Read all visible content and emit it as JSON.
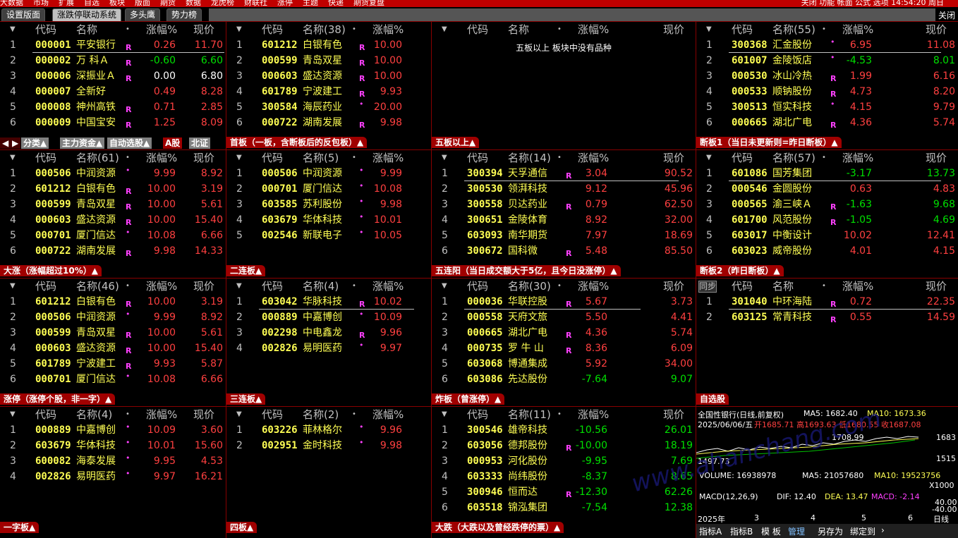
{
  "menubar": {
    "items": [
      "大数据",
      "市场",
      "扩展",
      "自选",
      "板块",
      "版面",
      "期货",
      "数据",
      "龙虎榜",
      "财联社",
      "涨停",
      "主题",
      "快递",
      "期货复盘"
    ],
    "right": "关闭 功能 帐面 公式 选项 14:54:20 周日"
  },
  "tabs": {
    "t1": "设置版面",
    "t2": "涨跌停联动系统",
    "t3": "多头鹰",
    "t4": "势力榜",
    "close": "关闭"
  },
  "colors": {
    "red": "#ff4040",
    "green": "#00e000",
    "code": "#ffff54",
    "grid": "#800000",
    "label": "#a00000"
  },
  "headers": {
    "code": "代码",
    "name": "名称",
    "pct": "涨幅%",
    "price": "现价",
    "sync": "同步"
  },
  "panels": [
    {
      "id": "p00",
      "title": "名称",
      "label": "",
      "rows": [
        [
          "1",
          "000001",
          "平安银行",
          "R",
          "0.26",
          "11.70",
          "r",
          "r"
        ],
        [
          "2",
          "000002",
          "万 科Ａ",
          "R",
          "-0.60",
          "6.60",
          "g",
          "g"
        ],
        [
          "3",
          "000006",
          "深振业Ａ",
          "R",
          "0.00",
          "6.80",
          "w",
          "w"
        ],
        [
          "4",
          "000007",
          "全新好",
          "",
          "0.49",
          "8.28",
          "r",
          "r"
        ],
        [
          "5",
          "000008",
          "神州高铁",
          "R",
          "0.71",
          "2.85",
          "r",
          "r"
        ],
        [
          "6",
          "000009",
          "中国宝安",
          "R",
          "1.25",
          "8.09",
          "r",
          "r"
        ]
      ]
    },
    {
      "id": "p01",
      "title": "名称(38)",
      "label": "首板（一板，含断板后的反包板）▲",
      "rows": [
        [
          "1",
          "601212",
          "白银有色",
          "R",
          "10.00",
          "",
          "r",
          "r"
        ],
        [
          "2",
          "000599",
          "青岛双星",
          "R",
          "10.00",
          "",
          "r",
          "r"
        ],
        [
          "3",
          "000603",
          "盛达资源",
          "R",
          "10.00",
          "",
          "r",
          "r"
        ],
        [
          "4",
          "601789",
          "宁波建工",
          "R",
          "9.93",
          "",
          "r",
          "r"
        ],
        [
          "5",
          "300584",
          "海辰药业",
          "•",
          "20.00",
          "",
          "r",
          "r"
        ],
        [
          "6",
          "000722",
          "湖南发展",
          "R",
          "9.98",
          "",
          "r",
          "r"
        ]
      ]
    },
    {
      "id": "p02",
      "title": "名称",
      "label": "五板以上▲",
      "empty": "五板以上 板块中没有品种",
      "rows": []
    },
    {
      "id": "p03",
      "title": "名称(55)",
      "label": "断板1（当日未更新则=昨日断板）▲",
      "rows": [
        [
          "1",
          "300368",
          "汇金股份",
          "•",
          "6.95",
          "11.08",
          "r",
          "r"
        ],
        [
          "2",
          "601007",
          "金陵饭店",
          "•",
          "-4.53",
          "8.01",
          "g",
          "g"
        ],
        [
          "3",
          "000530",
          "冰山冷热",
          "R",
          "1.99",
          "6.16",
          "r",
          "r"
        ],
        [
          "4",
          "000533",
          "顺钠股份",
          "R",
          "4.73",
          "8.20",
          "r",
          "r"
        ],
        [
          "5",
          "300513",
          "恒实科技",
          "•",
          "4.15",
          "9.79",
          "r",
          "r"
        ],
        [
          "6",
          "000665",
          "湖北广电",
          "R",
          "4.36",
          "5.74",
          "r",
          "r"
        ]
      ]
    },
    {
      "id": "p10",
      "title": "名称(61)",
      "label": "大涨（涨幅超过10%）▲",
      "rows": [
        [
          "1",
          "000506",
          "中润资源",
          "•",
          "9.99",
          "8.92",
          "r",
          "r"
        ],
        [
          "2",
          "601212",
          "白银有色",
          "R",
          "10.00",
          "3.19",
          "r",
          "r"
        ],
        [
          "3",
          "000599",
          "青岛双星",
          "R",
          "10.00",
          "5.61",
          "r",
          "r"
        ],
        [
          "4",
          "000603",
          "盛达资源",
          "R",
          "10.00",
          "15.40",
          "r",
          "r"
        ],
        [
          "5",
          "000701",
          "厦门信达",
          "•",
          "10.08",
          "6.66",
          "r",
          "r"
        ],
        [
          "6",
          "000722",
          "湖南发展",
          "R",
          "9.98",
          "14.33",
          "r",
          "r"
        ]
      ]
    },
    {
      "id": "p11",
      "title": "名称(5)",
      "label": "二连板▲",
      "rows": [
        [
          "1",
          "000506",
          "中润资源",
          "•",
          "9.99",
          "",
          "r",
          "r"
        ],
        [
          "2",
          "000701",
          "厦门信达",
          "•",
          "10.08",
          "",
          "r",
          "r"
        ],
        [
          "3",
          "603585",
          "苏利股份",
          "•",
          "9.98",
          "",
          "r",
          "r"
        ],
        [
          "4",
          "603679",
          "华体科技",
          "•",
          "10.01",
          "",
          "r",
          "r"
        ],
        [
          "5",
          "002546",
          "新联电子",
          "•",
          "10.05",
          "",
          "r",
          "r"
        ]
      ]
    },
    {
      "id": "p12",
      "title": "名称(14)",
      "label": "五连阳（当日成交额大于5亿，且今日没涨停）▲",
      "rows": [
        [
          "1",
          "300394",
          "天孚通信",
          "R",
          "3.04",
          "90.52",
          "r",
          "r"
        ],
        [
          "2",
          "300530",
          "领湃科技",
          "",
          "9.12",
          "45.96",
          "r",
          "r"
        ],
        [
          "3",
          "300558",
          "贝达药业",
          "R",
          "0.79",
          "62.50",
          "r",
          "r"
        ],
        [
          "4",
          "300651",
          "金陵体育",
          "",
          "8.92",
          "32.00",
          "r",
          "r"
        ],
        [
          "5",
          "603093",
          "南华期货",
          "",
          "7.97",
          "18.69",
          "r",
          "r"
        ],
        [
          "6",
          "300672",
          "国科微",
          "R",
          "5.48",
          "85.50",
          "r",
          "r"
        ]
      ]
    },
    {
      "id": "p13",
      "title": "名称(57)",
      "label": "断板2（昨日断板）▲",
      "rows": [
        [
          "1",
          "601086",
          "国芳集团",
          "",
          "-3.17",
          "13.73",
          "g",
          "g"
        ],
        [
          "2",
          "000546",
          "金圆股份",
          "",
          "0.63",
          "4.83",
          "r",
          "r"
        ],
        [
          "3",
          "000565",
          "渝三峡Ａ",
          "R",
          "-1.63",
          "9.68",
          "g",
          "g"
        ],
        [
          "4",
          "601700",
          "风范股份",
          "R",
          "-1.05",
          "4.69",
          "g",
          "g"
        ],
        [
          "5",
          "603017",
          "中衡设计",
          "",
          "10.02",
          "12.41",
          "r",
          "r"
        ],
        [
          "6",
          "603023",
          "威帝股份",
          "",
          "4.01",
          "4.15",
          "r",
          "r"
        ]
      ]
    },
    {
      "id": "p20",
      "title": "名称(46)",
      "label": "涨停（涨停个股，非一字）▲",
      "rows": [
        [
          "1",
          "601212",
          "白银有色",
          "R",
          "10.00",
          "3.19",
          "r",
          "r"
        ],
        [
          "2",
          "000506",
          "中润资源",
          "•",
          "9.99",
          "8.92",
          "r",
          "r"
        ],
        [
          "3",
          "000599",
          "青岛双星",
          "R",
          "10.00",
          "5.61",
          "r",
          "r"
        ],
        [
          "4",
          "000603",
          "盛达资源",
          "R",
          "10.00",
          "15.40",
          "r",
          "r"
        ],
        [
          "5",
          "601789",
          "宁波建工",
          "R",
          "9.93",
          "5.87",
          "r",
          "r"
        ],
        [
          "6",
          "000701",
          "厦门信达",
          "•",
          "10.08",
          "6.66",
          "r",
          "r"
        ]
      ]
    },
    {
      "id": "p21",
      "title": "名称(4)",
      "label": "三连板▲",
      "rows": [
        [
          "1",
          "603042",
          "华脉科技",
          "R",
          "10.02",
          "",
          "r",
          "r"
        ],
        [
          "2",
          "000889",
          "中嘉博创",
          "•",
          "10.09",
          "",
          "r",
          "r"
        ],
        [
          "3",
          "002298",
          "中电鑫龙",
          "R",
          "9.96",
          "",
          "r",
          "r"
        ],
        [
          "4",
          "002826",
          "易明医药",
          "•",
          "9.97",
          "",
          "r",
          "r"
        ]
      ]
    },
    {
      "id": "p22",
      "title": "名称(30)",
      "label": "炸板（曾涨停）▲",
      "rows": [
        [
          "1",
          "000036",
          "华联控股",
          "R",
          "5.67",
          "3.73",
          "r",
          "r"
        ],
        [
          "2",
          "000558",
          "天府文旅",
          "",
          "5.50",
          "4.41",
          "r",
          "r"
        ],
        [
          "3",
          "000665",
          "湖北广电",
          "R",
          "4.36",
          "5.74",
          "r",
          "r"
        ],
        [
          "4",
          "000735",
          "罗 牛 山",
          "R",
          "8.36",
          "6.09",
          "r",
          "r"
        ],
        [
          "5",
          "603068",
          "博通集成",
          "",
          "5.92",
          "34.00",
          "r",
          "r"
        ],
        [
          "6",
          "603086",
          "先达股份",
          "",
          "-7.64",
          "9.07",
          "g",
          "g"
        ]
      ]
    },
    {
      "id": "p23",
      "title": "名称",
      "label": "自选股",
      "sync": true,
      "rows": [
        [
          "1",
          "301040",
          "中环海陆",
          "R",
          "0.72",
          "22.35",
          "r",
          "r"
        ],
        [
          "2",
          "603125",
          "常青科技",
          "R",
          "0.55",
          "14.59",
          "r",
          "r"
        ]
      ]
    },
    {
      "id": "p30",
      "title": "名称(4)",
      "label": "一字板▲",
      "rows": [
        [
          "1",
          "000889",
          "中嘉博创",
          "•",
          "10.09",
          "3.60",
          "r",
          "r"
        ],
        [
          "2",
          "603679",
          "华体科技",
          "•",
          "10.01",
          "15.60",
          "r",
          "r"
        ],
        [
          "3",
          "600082",
          "海泰发展",
          "•",
          "9.95",
          "4.53",
          "r",
          "r"
        ],
        [
          "4",
          "002826",
          "易明医药",
          "•",
          "9.97",
          "16.21",
          "r",
          "r"
        ]
      ]
    },
    {
      "id": "p31",
      "title": "名称(2)",
      "label": "四板▲",
      "rows": [
        [
          "1",
          "603226",
          "菲林格尔",
          "•",
          "9.96",
          "",
          "r",
          "r"
        ],
        [
          "2",
          "002951",
          "金时科技",
          "•",
          "9.98",
          "",
          "r",
          "r"
        ]
      ]
    },
    {
      "id": "p32",
      "title": "名称(11)",
      "label": "大跌（大跌以及曾经跌停的票）▲",
      "rows": [
        [
          "1",
          "300546",
          "雄帝科技",
          "",
          "-10.56",
          "26.01",
          "g",
          "g"
        ],
        [
          "2",
          "603056",
          "德邦股份",
          "R",
          "-10.00",
          "18.19",
          "g",
          "g"
        ],
        [
          "3",
          "000953",
          "河化股份",
          "",
          "-9.95",
          "7.69",
          "g",
          "g"
        ],
        [
          "4",
          "603333",
          "尚纬股份",
          "",
          "-8.37",
          "8.65",
          "g",
          "g"
        ],
        [
          "5",
          "300946",
          "恒而达",
          "R",
          "-12.30",
          "62.26",
          "g",
          "g"
        ],
        [
          "6",
          "603518",
          "锦泓集团",
          "",
          "-7.54",
          "12.38",
          "g",
          "g"
        ]
      ]
    }
  ],
  "subtabs": [
    "◀",
    "▶",
    "分类▲",
    "主力资金▲",
    "自动选股▲",
    "A股",
    "北证"
  ],
  "chart": {
    "title": "全国性银行(日线,前复权)",
    "ma5": "MA5: 1682.40",
    "ma10": "MA10: 1673.36",
    "date": "2025/06/06/五",
    "ohlc": "开1685.71 高1693.63 低1680.55 收1687.08",
    "hi": "1708.99",
    "lo": "1497.73",
    "yhi": "1683",
    "ylo": "1515",
    "vol": "VOLUME: 16938978",
    "vma5": "MA5: 21057680",
    "vma10": "MA10: 19523756",
    "mult": "X1000",
    "macd": "MACD(12,26,9)",
    "dif": "DIF: 12.40",
    "dea": "DEA: 13.47",
    "macdv": "MACD: -2.14",
    "m1": "40.00",
    "m2": "-40.00",
    "year": "2025年",
    "months": [
      "3",
      "4",
      "5",
      "6"
    ],
    "period": "日线",
    "btm": [
      "指标A",
      "指标B",
      "模 板",
      "管理",
      "另存为",
      "绑定到",
      "›"
    ]
  },
  "watermark": "www.ahanchang.com"
}
